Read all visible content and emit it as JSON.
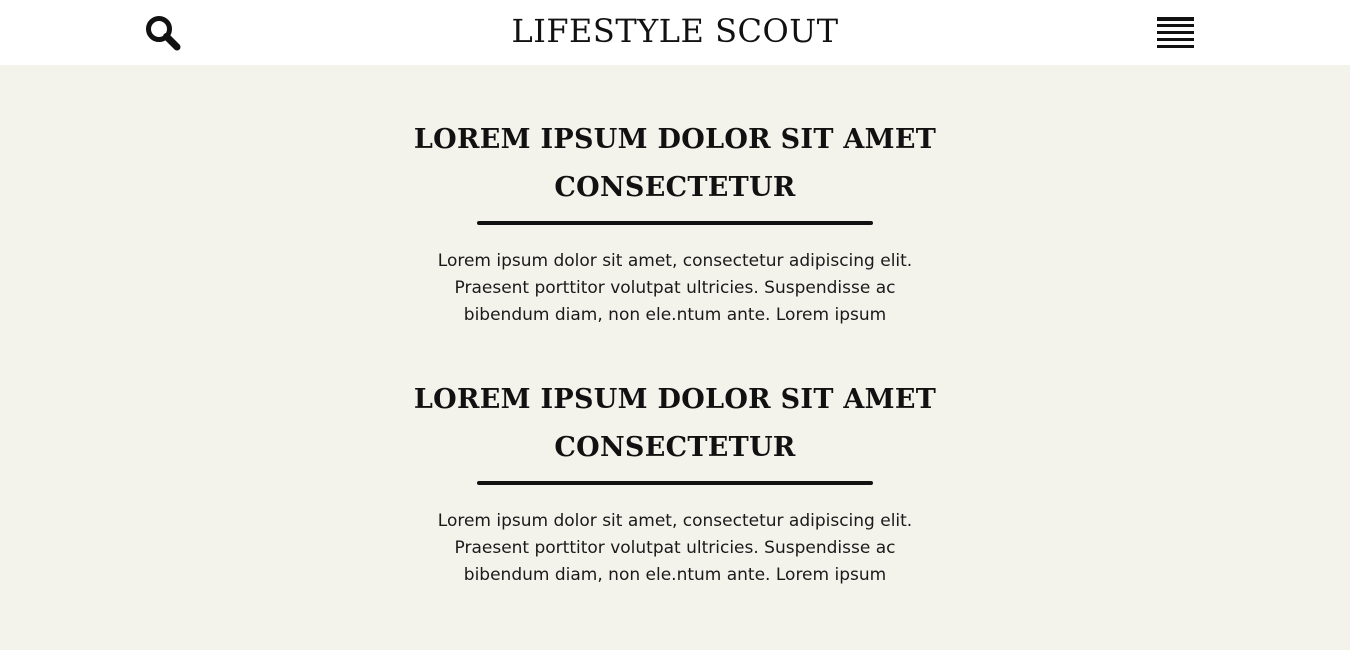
{
  "header": {
    "site_title": "LIFESTYLE SCOUT",
    "search_icon": "search-icon",
    "menu_icon": "hamburger-menu-icon"
  },
  "articles": [
    {
      "title_line1": "LOREM IPSUM DOLOR SIT AMET",
      "title_line2": "CONSECTETUR",
      "body_line1": "Lorem ipsum dolor sit amet, consectetur adipiscing elit.",
      "body_line2": "Praesent porttitor volutpat ultricies. Suspendisse ac",
      "body_line3": "bibendum diam, non ele.ntum ante. Lorem ipsum"
    },
    {
      "title_line1": "LOREM IPSUM DOLOR SIT AMET",
      "title_line2": "CONSECTETUR",
      "body_line1": "Lorem ipsum dolor sit amet, consectetur adipiscing elit.",
      "body_line2": "Praesent porttitor volutpat ultricies. Suspendisse ac",
      "body_line3": "bibendum diam, non ele.ntum ante. Lorem ipsum"
    }
  ],
  "colors": {
    "header_bg": "#ffffff",
    "page_bg": "#f3f2eb",
    "text": "#111111"
  }
}
